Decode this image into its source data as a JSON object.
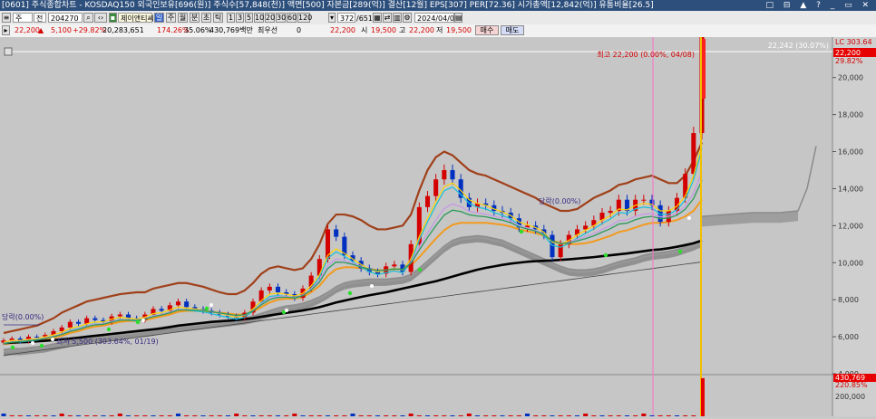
{
  "window": {
    "title": "[0601] 주식종합차트 - KOSDAQ150 외국인보유[696(원)] 주식수[57,848(천)] 액면[500] 자본금[289(억)] 결산[12월] EPS[307] PER[72.36] 시가총액[12,842(억)] 유통비율[26.5]"
  },
  "toolbar": {
    "period_select": "주",
    "market_select": "전",
    "code": "204270",
    "stock_name": "제이앤티씨",
    "periods": [
      "일",
      "주",
      "월",
      "분",
      "초",
      "틱"
    ],
    "active_period": "일",
    "minute_steps": [
      "1",
      "3",
      "5",
      "10",
      "20",
      "30",
      "60",
      "120"
    ],
    "count_field": "372",
    "count_total": "/651",
    "date": "2024/04/08"
  },
  "quote": {
    "price": "22,200",
    "change": "5,100",
    "change_pct": "+29.82%",
    "volume_value": "20,283,651",
    "ratio1": "174.26%",
    "ratio2": "35.06%",
    "trade_value": "430,769백만",
    "pref_label": "최우선",
    "pref_value": "0",
    "current": "22,200",
    "open_label": "시",
    "open": "19,500",
    "high_label": "고",
    "high": "22,200",
    "low_label": "저",
    "low": "19,500",
    "buy_label": "매수",
    "sell_label": "매도"
  },
  "colors": {
    "up": "#d40000",
    "down": "#0030c0",
    "ma_slow": "#000000",
    "ma_orange": "#f39a1e",
    "envelope": "#a0401a",
    "cloud": "#7d7d7d",
    "price_marker": "#ff2020",
    "vertical_marker": "#f0c000"
  },
  "chart_data": {
    "type": "line",
    "x_label_note": "",
    "ylim": [
      4000,
      21500
    ],
    "y_ticks": [
      20000,
      18000,
      16000,
      14000,
      12000,
      10000,
      8000,
      6000,
      4000
    ],
    "y_tick_labels": [
      "20,000",
      "18,000",
      "16,000",
      "14,000",
      "12,000",
      "10,000",
      "8,000",
      "6,000",
      "4,000"
    ],
    "grid": false,
    "annotations": {
      "top_right_value": "22,242 (30.07%)",
      "axis_top_label": "LC 303.64",
      "axis_price_label": "22,200",
      "axis_price_pct": "29.82%",
      "high_marker": "최고 22,200 (0.00%, 04/08)",
      "left_start": "당락(0.00%)",
      "mid_label": "당락(0.00%)",
      "low_marker": "최저 5,500 (303.64%, 01/19)"
    },
    "series": [
      {
        "key": "price",
        "values": [
          5800,
          5900,
          5750,
          6000,
          5950,
          6100,
          6300,
          6500,
          6800,
          6700,
          7000,
          6900,
          6800,
          7100,
          7200,
          7000,
          6900,
          7200,
          7500,
          7400,
          7700,
          7900,
          7600,
          7500,
          7400,
          7300,
          7200,
          7100,
          7000,
          7300,
          7900,
          8500,
          8700,
          8400,
          8300,
          8100,
          8600,
          9300,
          10200,
          11800,
          11400,
          10400,
          10100,
          9700,
          9500,
          9400,
          9800,
          9900,
          9500,
          11000,
          13000,
          13600,
          14500,
          15000,
          14500,
          13500,
          13000,
          13200,
          13100,
          12800,
          12700,
          12400,
          11900,
          12000,
          11800,
          11500,
          10300,
          11000,
          11500,
          11800,
          12000,
          12300,
          12700,
          12800,
          13400,
          12800,
          13400,
          13400,
          13100,
          12200,
          12800,
          13500,
          14800,
          17000,
          22200
        ]
      },
      {
        "key": "ma_fast",
        "values": [
          5700,
          5800,
          5800,
          5850,
          5900,
          6000,
          6100,
          6250,
          6450,
          6550,
          6700,
          6800,
          6800,
          6950,
          7050,
          7000,
          6950,
          7050,
          7250,
          7300,
          7450,
          7600,
          7550,
          7500,
          7450,
          7350,
          7250,
          7150,
          7050,
          7150,
          7500,
          7950,
          8300,
          8350,
          8300,
          8200,
          8350,
          8750,
          9350,
          10400,
          10750,
          10500,
          10200,
          9900,
          9650,
          9500,
          9600,
          9700,
          9600,
          10200,
          11400,
          12400,
          13300,
          14100,
          14300,
          13900,
          13400,
          13200,
          13100,
          12900,
          12750,
          12550,
          12200,
          12050,
          11900,
          11650,
          11100,
          11000,
          11200,
          11500,
          11750,
          12000,
          12300,
          12550,
          12900,
          12850,
          13100,
          13200,
          13150,
          12800,
          12800,
          13050,
          13600,
          14700,
          16400
        ]
      },
      {
        "key": "ma_slow",
        "values": [
          5650,
          5680,
          5700,
          5720,
          5750,
          5780,
          5820,
          5860,
          5900,
          5950,
          6000,
          6050,
          6100,
          6150,
          6200,
          6250,
          6300,
          6350,
          6400,
          6450,
          6520,
          6600,
          6650,
          6700,
          6750,
          6800,
          6830,
          6860,
          6900,
          6950,
          7000,
          7080,
          7150,
          7220,
          7290,
          7350,
          7420,
          7500,
          7600,
          7720,
          7850,
          7950,
          8050,
          8150,
          8240,
          8320,
          8400,
          8500,
          8600,
          8700,
          8800,
          8900,
          9000,
          9120,
          9250,
          9380,
          9500,
          9620,
          9720,
          9800,
          9880,
          9950,
          10000,
          10050,
          10080,
          10100,
          10120,
          10150,
          10180,
          10220,
          10260,
          10300,
          10350,
          10400,
          10450,
          10500,
          10560,
          10620,
          10680,
          10720,
          10780,
          10860,
          10950,
          11050,
          11200
        ]
      },
      {
        "key": "ma_orange",
        "values": [
          5600,
          5650,
          5700,
          5750,
          5800,
          5850,
          5950,
          6050,
          6200,
          6300,
          6450,
          6550,
          6600,
          6700,
          6800,
          6850,
          6850,
          6900,
          7000,
          7100,
          7200,
          7350,
          7400,
          7400,
          7400,
          7350,
          7300,
          7250,
          7200,
          7200,
          7350,
          7600,
          7850,
          8000,
          8050,
          8050,
          8150,
          8400,
          8750,
          9300,
          9650,
          9750,
          9750,
          9700,
          9650,
          9600,
          9600,
          9650,
          9650,
          9850,
          10300,
          10800,
          11300,
          11750,
          12050,
          12150,
          12150,
          12150,
          12150,
          12100,
          12050,
          11950,
          11800,
          11700,
          11600,
          11450,
          11200,
          11050,
          11000,
          11000,
          11050,
          11150,
          11300,
          11450,
          11650,
          11750,
          11900,
          12050,
          12150,
          12150,
          12200,
          12300,
          12500,
          12800,
          13400
        ]
      },
      {
        "key": "envelope",
        "values": [
          6200,
          6300,
          6400,
          6500,
          6600,
          6800,
          7000,
          7300,
          7500,
          7700,
          7900,
          8000,
          8100,
          8200,
          8300,
          8350,
          8400,
          8400,
          8600,
          8700,
          8800,
          8900,
          8900,
          8800,
          8700,
          8550,
          8400,
          8300,
          8300,
          8500,
          8900,
          9400,
          9700,
          9800,
          9700,
          9600,
          9700,
          10200,
          11000,
          12100,
          12600,
          12600,
          12500,
          12300,
          12000,
          11800,
          11800,
          11900,
          12000,
          12600,
          13900,
          15000,
          15700,
          16000,
          15800,
          15400,
          15000,
          14800,
          14700,
          14500,
          14300,
          14100,
          13900,
          13700,
          13500,
          13200,
          13000,
          12800,
          12800,
          12900,
          13200,
          13500,
          13700,
          13900,
          14200,
          14300,
          14500,
          14600,
          14700,
          14500,
          14300,
          14300,
          14700,
          15500,
          16500
        ]
      },
      {
        "key": "ma_gray",
        "values": [
          5200,
          5250,
          5250,
          5300,
          5350,
          5400,
          5500,
          5600,
          5700,
          5800,
          5900,
          5950,
          6000,
          6050,
          6100,
          6150,
          6200,
          6250,
          6300,
          6400,
          6450,
          6500,
          6550,
          6600,
          6650,
          6700,
          6750,
          6800,
          6850,
          6900,
          7000,
          7150,
          7300,
          7450,
          7550,
          7600,
          7700,
          7850,
          8050,
          8300,
          8600,
          8800,
          8900,
          8950,
          9000,
          9000,
          9000,
          9050,
          9100,
          9250,
          9600,
          10000,
          10400,
          10800,
          11100,
          11250,
          11300,
          11350,
          11300,
          11200,
          11100,
          10900,
          10700,
          10500,
          10300,
          10100,
          9900,
          9700,
          9550,
          9500,
          9500,
          9550,
          9650,
          9800,
          9950,
          10050,
          10150,
          10300,
          10400,
          10450,
          10500,
          10600,
          10750,
          10900,
          11100
        ]
      },
      {
        "key": "trend_line",
        "values": [
          5000,
          5060,
          5120,
          5180,
          5240,
          5300,
          5360,
          5420,
          5480,
          5540,
          5600,
          5660,
          5720,
          5780,
          5840,
          5900,
          5960,
          6020,
          6080,
          6140,
          6200,
          6260,
          6320,
          6380,
          6440,
          6500,
          6560,
          6620,
          6680,
          6740,
          6800,
          6860,
          6920,
          6980,
          7040,
          7100,
          7160,
          7220,
          7280,
          7340,
          7400,
          7460,
          7520,
          7580,
          7640,
          7700,
          7760,
          7820,
          7880,
          7940,
          8000,
          8060,
          8120,
          8180,
          8240,
          8300,
          8360,
          8420,
          8480,
          8540,
          8600,
          8660,
          8720,
          8780,
          8840,
          8900,
          8960,
          9020,
          9080,
          9140,
          9200,
          9260,
          9320,
          9380,
          9440,
          9500,
          9560,
          9620,
          9680,
          9740,
          9800,
          9860,
          9920,
          9980,
          10040
        ]
      }
    ],
    "volume": {
      "ylabel_top": "430,769",
      "ylabel_pct": "220.85%",
      "tick": "200,000",
      "last": 430769,
      "max": 460000
    }
  }
}
